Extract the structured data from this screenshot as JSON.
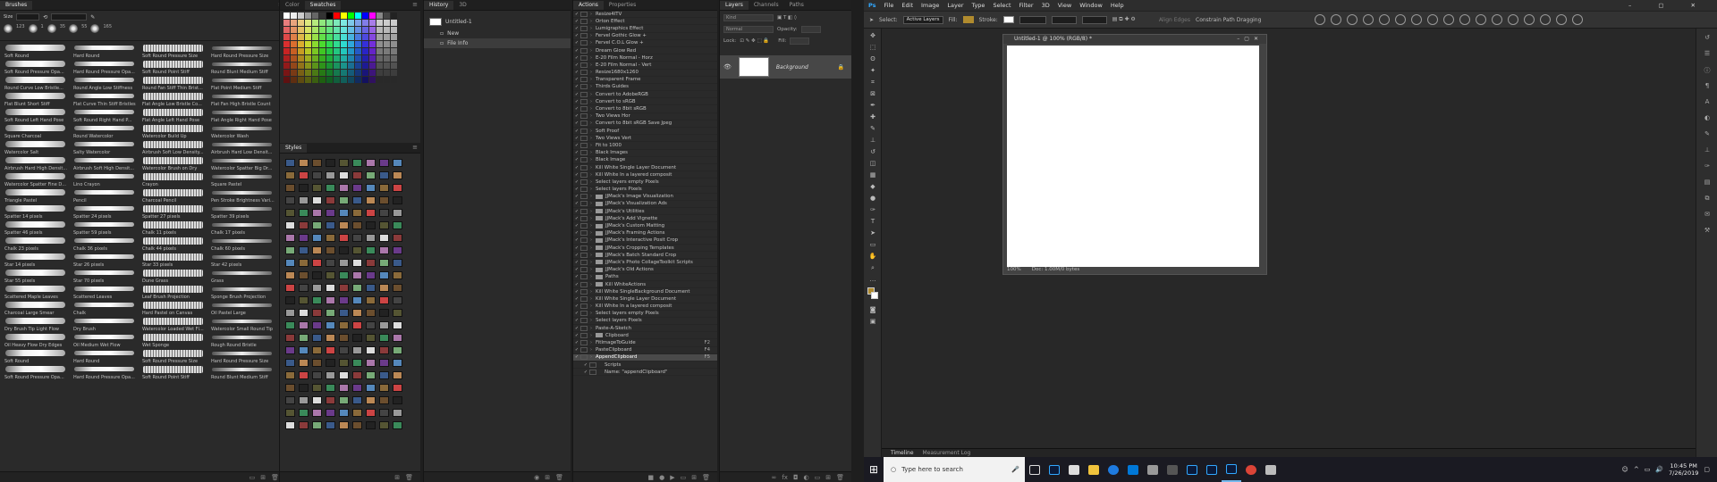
{
  "brushes_panel": {
    "tabs": [
      "Brushes"
    ],
    "size_value": "",
    "recent_sizes": [
      "123",
      "1",
      "35",
      "55",
      "165"
    ],
    "brushes": [
      "Soft Round",
      "Hard Round",
      "Soft Round Pressure Size",
      "Hard Round Pressure Size",
      "Soft Round Pressure Opa...",
      "Hard Round Pressure Opa...",
      "Soft Round Point Stiff",
      "Round Blunt Medium Stiff",
      "Round Curve Low Bristle...",
      "Round Angle Low Stiffness",
      "Round Fan Stiff Thin Brist...",
      "Flat Point Medium Stiff",
      "Flat Blunt Short Stiff",
      "Flat Curve Thin Stiff Bristles",
      "Flat Angle Low Bristle Co...",
      "Flat Fan High Bristle Count",
      "Soft Round Left Hand Pose",
      "Soft Round Right Hand P...",
      "Flat Angle Left Hand Pose",
      "Flat Angle Right Hand Pose",
      "Square Charcoal",
      "Round Watercolor",
      "Watercolor Build Up",
      "Watercolor Wash",
      "Watercolor Salt",
      "Salty Watercolor",
      "Airbrush Soft Low Density...",
      "Airbrush Hard Low Densit...",
      "Airbrush Hard High Densit...",
      "Airbrush Soft High Densit...",
      "Watercolor Brush on Dry",
      "Watercolor Spatter Big Dr...",
      "Watercolor Spatter Fine D...",
      "Lino Crayon",
      "Crayon",
      "Square Pastel",
      "Triangle Pastel",
      "Pencil",
      "Charcoal Pencil",
      "Pen Stroke Brightness Vari...",
      "Spatter 14 pixels",
      "Spatter 24 pixels",
      "Spatter 27 pixels",
      "Spatter 39 pixels",
      "Spatter 46 pixels",
      "Spatter 59 pixels",
      "Chalk 11 pixels",
      "Chalk 17 pixels",
      "Chalk 23 pixels",
      "Chalk 36 pixels",
      "Chalk 44 pixels",
      "Chalk 60 pixels",
      "Star 14 pixels",
      "Star 26 pixels",
      "Star 33 pixels",
      "Star 42 pixels",
      "Star 55 pixels",
      "Star 70 pixels",
      "Dune Grass",
      "Grass",
      "Scattered Maple Leaves",
      "Scattered Leaves",
      "Leaf Brush Projection",
      "Sponge Brush Projection",
      "Charcoal Large Smear",
      "Chalk",
      "Hard Pastel on Canvas",
      "Oil Pastel Large",
      "Dry Brush Tip Light Flow",
      "Dry Brush",
      "Watercolor Loaded Wet Fl...",
      "Watercolor Small Round Tip",
      "Oil Heavy Flow Dry Edges",
      "Oil Medium Wet Flow",
      "Wet Sponge",
      "Rough Round Bristle",
      "Soft Round",
      "Hard Round",
      "Soft Round Pressure Size",
      "Hard Round Pressure Size",
      "Soft Round Pressure Opa...",
      "Hard Round Pressure Opa...",
      "Soft Round Point Stiff",
      "Round Blunt Medium Stiff"
    ]
  },
  "swatches_panel": {
    "tabs": [
      "Color",
      "Swatches"
    ],
    "active_tab": "Swatches",
    "styles_title": "Styles"
  },
  "history_panel": {
    "tabs": [
      "History",
      "3D"
    ],
    "document": "Untitled-1",
    "states": [
      "New",
      "File Info"
    ]
  },
  "actions_panel": {
    "tabs": [
      "Actions",
      "Properties"
    ],
    "rows": [
      {
        "label": "Resize4ITV",
        "type": "action"
      },
      {
        "label": "Orton Effect",
        "type": "action"
      },
      {
        "label": "Lumigraphics Effect",
        "type": "action"
      },
      {
        "label": "Fervel Gothic Glow +",
        "type": "action"
      },
      {
        "label": "Fervel C.O.L Glow +",
        "type": "action"
      },
      {
        "label": "Dream Glow Red",
        "type": "action"
      },
      {
        "label": "E-20 Film Normal - Horz",
        "type": "action"
      },
      {
        "label": "E-20 Film Normal - Vert",
        "type": "action"
      },
      {
        "label": "Resize1680x1260",
        "type": "action"
      },
      {
        "label": "Transparent Frame",
        "type": "action"
      },
      {
        "label": "Thirds Guides",
        "type": "action"
      },
      {
        "label": "Convert to AdobeRGB",
        "type": "action"
      },
      {
        "label": "Convert to sRGB",
        "type": "action"
      },
      {
        "label": "Convert to 8bit sRGB",
        "type": "action"
      },
      {
        "label": "Two Views Hor",
        "type": "action"
      },
      {
        "label": "Convert to 8bit sRGB Save Jpeg",
        "type": "action"
      },
      {
        "label": "Soft Proof",
        "type": "action"
      },
      {
        "label": "Two Views Vert",
        "type": "action"
      },
      {
        "label": "Fit to 1000",
        "type": "action"
      },
      {
        "label": "Black Images",
        "type": "action"
      },
      {
        "label": "Black Image",
        "type": "action"
      },
      {
        "label": "Kill White Single Layer Document",
        "type": "action"
      },
      {
        "label": "Kill White In a layered composit",
        "type": "action"
      },
      {
        "label": "Select layers empty Pixels",
        "type": "action"
      },
      {
        "label": "Select layers Pixels",
        "type": "action"
      },
      {
        "label": "JJMack's Image Visualization",
        "type": "set"
      },
      {
        "label": "JJMack's Visualization Ads",
        "type": "set"
      },
      {
        "label": "JJMack's Utilities",
        "type": "set"
      },
      {
        "label": "JJMack's Add Vignette",
        "type": "set"
      },
      {
        "label": "JJMack's Custom Matting",
        "type": "set"
      },
      {
        "label": "JJMack's Framing Actions",
        "type": "set"
      },
      {
        "label": "JJMack's Interactive Posit Crop",
        "type": "set"
      },
      {
        "label": "JJMack's Cropping Templates",
        "type": "set"
      },
      {
        "label": "JJMack's Batch Standard Crop",
        "type": "set"
      },
      {
        "label": "JJMack's Photo CollageToolkit Scripts",
        "type": "set"
      },
      {
        "label": "JJMack's Old Actions",
        "type": "set"
      },
      {
        "label": "Paths",
        "type": "set"
      },
      {
        "label": "Kill WhiteActions",
        "type": "set"
      },
      {
        "label": "Kill White SingleBackground Document",
        "type": "action"
      },
      {
        "label": "Kill White Single Layer Document",
        "type": "action"
      },
      {
        "label": "Kill White In a layered composit",
        "type": "action"
      },
      {
        "label": "Select layers empty Pixels",
        "type": "action"
      },
      {
        "label": "Select layers Pixels",
        "type": "action"
      },
      {
        "label": "Paste-A-Sketch",
        "type": "action"
      },
      {
        "label": "Clipboard",
        "type": "set"
      },
      {
        "label": "FitImageToGuide",
        "type": "action",
        "key": "F2"
      },
      {
        "label": "PasteClipboard",
        "type": "action",
        "key": "F4"
      },
      {
        "label": "AppendClipboard",
        "type": "action",
        "key": "F5",
        "selected": true
      },
      {
        "label": "Scripts",
        "type": "step"
      },
      {
        "label": "Name: \"appendClipboard\"",
        "type": "step"
      }
    ]
  },
  "layers_panel": {
    "tabs": [
      "Layers",
      "Channels",
      "Paths"
    ],
    "kind_placeholder": "Kind",
    "blend_mode": "Normal",
    "opacity_label": "Opacity:",
    "lock_label": "Lock:",
    "fill_label": "Fill:",
    "layer_name": "Background"
  },
  "photoshop": {
    "menu": [
      "File",
      "Edit",
      "Image",
      "Layer",
      "Type",
      "Select",
      "Filter",
      "3D",
      "View",
      "Window",
      "Help"
    ],
    "options": {
      "select_label": "Select:",
      "select_value": "Active Layers",
      "fill_label": "Fill:",
      "stroke_label": "Stroke:",
      "align_edges": "Align Edges",
      "constrain": "Constrain Path Dragging"
    },
    "document_title": "Untitled-1 @ 100% (RGB/8) *",
    "zoom": "100%",
    "doc_info": "Doc: 1.00M/0 bytes",
    "timeline_tabs": [
      "Timeline",
      "Measurement Log"
    ]
  },
  "taskbar": {
    "search_placeholder": "Type here to search",
    "time": "10:45 PM",
    "date": "7/26/2019"
  }
}
